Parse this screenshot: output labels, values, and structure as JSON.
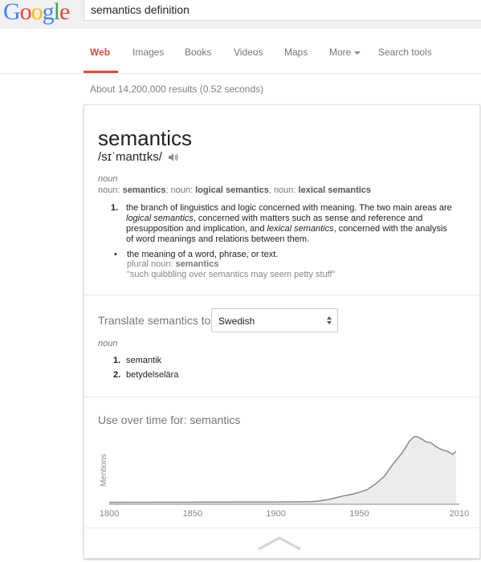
{
  "logo": {
    "letters": [
      "G",
      "o",
      "o",
      "g",
      "l",
      "e"
    ]
  },
  "search": {
    "value": "semantics definition"
  },
  "tabs": [
    {
      "label": "Web",
      "active": true
    },
    {
      "label": "Images"
    },
    {
      "label": "Books"
    },
    {
      "label": "Videos"
    },
    {
      "label": "Maps"
    },
    {
      "label": "More"
    },
    {
      "label": "Search tools"
    }
  ],
  "stats": "About 14,200,000 results (0.52 seconds)",
  "definition": {
    "word": "semantics",
    "phonetic": "/sɪˈmantɪks/",
    "pos": "noun",
    "forms": {
      "p1": "noun: ",
      "f1": "semantics",
      "p2": "; noun: ",
      "f2": "logical semantics",
      "p3": "; noun: ",
      "f3": "lexical semantics"
    },
    "sense1": {
      "num": "1.",
      "t1": "the branch of linguistics and logic concerned with meaning. The two main areas are ",
      "i1": "logical semantics",
      "t2": ", concerned with matters such as sense and reference and presupposition and implication, and ",
      "i2": "lexical semantics",
      "t3": ", concerned with the analysis of word meanings and relations between them."
    },
    "sense2": {
      "bullet": "•",
      "text": "the meaning of a word, phrase, or text.",
      "plural_prefix": "plural noun: ",
      "plural_word": "semantics",
      "example": "\"such quibbling over semantics may seem petty stuff\""
    }
  },
  "translate": {
    "label": "Translate semantics to",
    "language": "Swedish",
    "pos": "noun",
    "items": [
      {
        "num": "1.",
        "text": "semantik"
      },
      {
        "num": "2.",
        "text": "betydelselära"
      }
    ]
  },
  "usage": {
    "title": "Use over time for: semantics",
    "ylabel": "Mentions"
  },
  "chart_data": {
    "type": "area",
    "title": "Use over time for: semantics",
    "xlabel": "",
    "ylabel": "Mentions",
    "x_ticks": [
      1800,
      1850,
      1900,
      1950,
      2010
    ],
    "xlim": [
      1800,
      2010
    ],
    "grid": false,
    "colors": {
      "line": "#8a8a8a",
      "fill": "#ececec",
      "axis": "#bfbfbf"
    },
    "series": [
      {
        "x": [
          1800,
          1810,
          1820,
          1830,
          1840,
          1850,
          1860,
          1870,
          1880,
          1890,
          1900,
          1910,
          1920,
          1925,
          1930,
          1935,
          1940,
          1945,
          1950,
          1955,
          1960,
          1965,
          1970,
          1975,
          1978,
          1980,
          1983,
          1985,
          1988,
          1990,
          1993,
          1995,
          1998,
          2000,
          2003,
          2006,
          2008
        ],
        "y": [
          0.3,
          0.4,
          0.4,
          0.5,
          0.6,
          0.6,
          0.7,
          0.7,
          0.8,
          0.8,
          0.9,
          1.0,
          1.2,
          2.0,
          3.5,
          6,
          9,
          11,
          14,
          18,
          26,
          36,
          52,
          66,
          76,
          84,
          90,
          90,
          86,
          83,
          82,
          78,
          74,
          72,
          70,
          66,
          70
        ]
      }
    ]
  }
}
